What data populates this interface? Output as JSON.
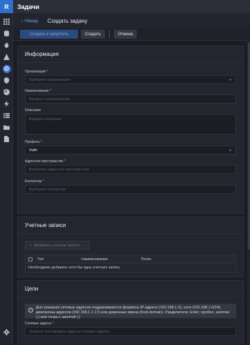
{
  "app": {
    "logo": "R",
    "title": "Задачи"
  },
  "rail": {
    "icons": [
      "grid-icon",
      "database-icon",
      "flame-icon",
      "warning-icon",
      "target-icon",
      "shield-icon",
      "pie-icon",
      "bolt-icon",
      "list-icon",
      "folder-icon",
      "document-icon"
    ],
    "settings_icon": "gear-icon"
  },
  "header": {
    "back_label": "Назад",
    "title": "Создать задачу"
  },
  "toolbar": {
    "primary_label": "Создать и запустить",
    "create_label": "Создать",
    "cancel_label": "Отмена"
  },
  "info_section": {
    "title": "Информация",
    "org_label": "Организация",
    "org_placeholder": "Выберите организацию",
    "name_label": "Наименование",
    "name_placeholder": "Введите наименование",
    "desc_label": "Описание",
    "desc_placeholder": "Введите описание",
    "profile_label": "Профиль",
    "profile_value": "Vulin",
    "addr_label": "Адресное пространство",
    "addr_placeholder": "Выберите адресное пространство",
    "collector_label": "Коллектор",
    "collector_placeholder": "Выберите коллектор"
  },
  "accounts_section": {
    "title": "Учетные записи",
    "add_label": "Добавить учетные записи",
    "columns": [
      "Тип",
      "Наименование",
      "Логин"
    ],
    "empty_message": "Необходимо добавить хотя бы одну учетную запись"
  },
  "targets_section": {
    "title": "Цели",
    "info_text": "Для указания сетевых адресов поддерживаются форматы IP-адреса (192.168.1.0), сети (192.168.1.0/24), диапазоны адресов (192.168.1.1-17) или доменные имена (host.domain). Разделители: Enter, пробел, запятая (,) или точка с запятой (;)",
    "addr_label": "Сетевые адреса",
    "addr_placeholder": "Укажите или введите адреса сетевые адреса"
  },
  "colors": {
    "accent": "#3b6fd6",
    "background": "#1b1d24",
    "card": "#23262e"
  }
}
